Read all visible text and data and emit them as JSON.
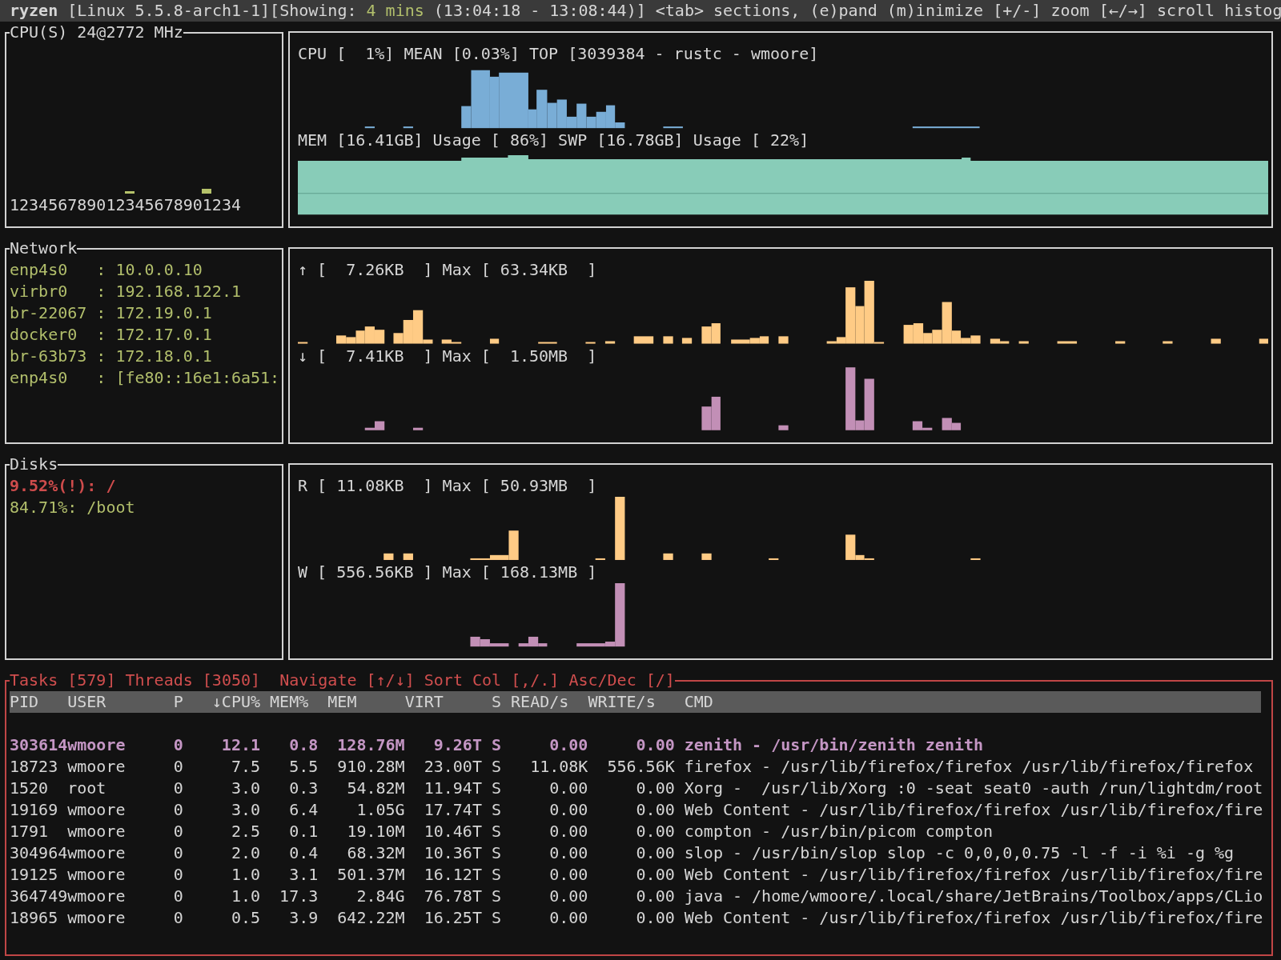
{
  "header": {
    "host": "ryzen",
    "before": " [Linux 5.5.8-arch1-1][Showing: ",
    "duration": "4 mins",
    "after": " (13:04:18 - 13:08:44)] <tab> sections, (e)pand (m)inimize [+/-] zoom [←/→] scroll histog"
  },
  "cpu": {
    "title": "CPU(S) 24@2772 MHz",
    "core_labels": "123456789012345678901234",
    "summary": "CPU [  1%] MEAN [0.03%] TOP [3039384 - rustc - wmoore]",
    "memory": "MEM [16.41GB] Usage [ 86%] SWP [16.78GB] Usage [ 22%]"
  },
  "network": {
    "title": "Network",
    "interfaces": [
      "enp4s0   : 10.0.0.10",
      "virbr0   : 192.168.122.1",
      "br-22067 : 172.19.0.1",
      "docker0  : 172.17.0.1",
      "br-63b73 : 172.18.0.1",
      "enp4s0   : [fe80::16e1:6a51:"
    ],
    "upload": "↑ [  7.26KB  ] Max [ 63.34KB  ]",
    "download": "↓ [  7.41KB  ] Max [  1.50MB  ]"
  },
  "disks": {
    "title": "Disks",
    "mounts": [
      {
        "text": "9.52%(!): /",
        "warning": true
      },
      {
        "text": "84.71%: /boot",
        "warning": false
      }
    ],
    "read": "R [ 11.08KB  ] Max [ 50.93MB  ]",
    "write": "W [ 556.56KB ] Max [ 168.13MB ]"
  },
  "processes": {
    "title": "Tasks [579] Threads [3050]  Navigate [↑/↓] Sort Col [,/.] Asc/Dec [/]",
    "columns": [
      "PID",
      "USER",
      "P",
      "↓CPU%",
      "MEM%",
      "MEM",
      "VIRT",
      "S",
      "READ/s",
      "WRITE/s",
      "CMD"
    ],
    "rows": [
      {
        "cells": [
          "303614",
          "wmoore",
          "0",
          "12.1",
          "0.8",
          "128.76M",
          "9.26T",
          "S",
          "0.00",
          "0.00",
          "zenith - /usr/bin/zenith zenith"
        ],
        "selected": true
      },
      {
        "cells": [
          "18723",
          "wmoore",
          "0",
          "7.5",
          "5.5",
          "910.28M",
          "23.00T",
          "S",
          "11.08K",
          "556.56K",
          "firefox - /usr/lib/firefox/firefox /usr/lib/firefox/firefox"
        ],
        "selected": false
      },
      {
        "cells": [
          "1520",
          "root",
          "0",
          "3.0",
          "0.3",
          "54.82M",
          "11.94T",
          "S",
          "0.00",
          "0.00",
          "Xorg -  /usr/lib/Xorg :0 -seat seat0 -auth /run/lightdm/root"
        ],
        "selected": false
      },
      {
        "cells": [
          "19169",
          "wmoore",
          "0",
          "3.0",
          "6.4",
          "1.05G",
          "17.74T",
          "S",
          "0.00",
          "0.00",
          "Web Content - /usr/lib/firefox/firefox /usr/lib/firefox/fire"
        ],
        "selected": false
      },
      {
        "cells": [
          "1791",
          "wmoore",
          "0",
          "2.5",
          "0.1",
          "19.10M",
          "10.46T",
          "S",
          "0.00",
          "0.00",
          "compton - /usr/bin/picom compton"
        ],
        "selected": false
      },
      {
        "cells": [
          "304964",
          "wmoore",
          "0",
          "2.0",
          "0.4",
          "68.32M",
          "10.36T",
          "S",
          "0.00",
          "0.00",
          "slop - /usr/bin/slop slop -c 0,0,0,0.75 -l -f -i %i -g %g"
        ],
        "selected": false
      },
      {
        "cells": [
          "19125",
          "wmoore",
          "0",
          "1.0",
          "3.1",
          "501.37M",
          "16.12T",
          "S",
          "0.00",
          "0.00",
          "Web Content - /usr/lib/firefox/firefox /usr/lib/firefox/fire"
        ],
        "selected": false
      },
      {
        "cells": [
          "364749",
          "wmoore",
          "0",
          "1.0",
          "17.3",
          "2.84G",
          "76.78T",
          "S",
          "0.00",
          "0.00",
          "java - /home/wmoore/.local/share/JetBrains/Toolbox/apps/CLio"
        ],
        "selected": false
      },
      {
        "cells": [
          "18965",
          "wmoore",
          "0",
          "0.5",
          "3.9",
          "642.22M",
          "16.25T",
          "S",
          "0.00",
          "0.00",
          "Web Content - /usr/lib/firefox/firefox /usr/lib/firefox/fire"
        ],
        "selected": false
      }
    ]
  }
}
